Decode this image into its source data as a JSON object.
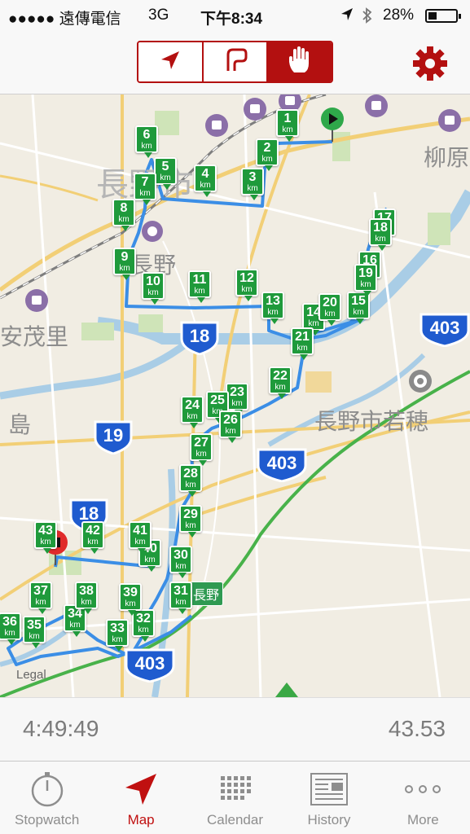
{
  "status_bar": {
    "signal": "●●●●●",
    "carrier": "遠傳電信",
    "network": "3G",
    "time": "下午8:34",
    "battery": "28%"
  },
  "toolbar": {
    "segments": [
      {
        "name": "navigation-arrow-icon",
        "active": false
      },
      {
        "name": "route-shape-icon",
        "active": false
      },
      {
        "name": "hand-icon",
        "active": true
      }
    ],
    "settings_icon": "gear-icon",
    "accent_color": "#b31010"
  },
  "map": {
    "labels": {
      "nagano_city": "長野市",
      "yanagihara": "柳原",
      "nagano": "長野",
      "amori": "安茂里",
      "shima": "島",
      "wakaho": "長野市若穂",
      "nagano_station": "長野"
    },
    "legal": "Legal",
    "route_color": "#3b8ee6",
    "markers": [
      {
        "n": "1"
      },
      {
        "n": "2"
      },
      {
        "n": "3"
      },
      {
        "n": "4"
      },
      {
        "n": "5"
      },
      {
        "n": "6"
      },
      {
        "n": "7"
      },
      {
        "n": "8"
      },
      {
        "n": "9"
      },
      {
        "n": "10"
      },
      {
        "n": "11"
      },
      {
        "n": "12"
      },
      {
        "n": "13"
      },
      {
        "n": "14"
      },
      {
        "n": "15"
      },
      {
        "n": "16"
      },
      {
        "n": "17"
      },
      {
        "n": "18"
      },
      {
        "n": "19"
      },
      {
        "n": "20"
      },
      {
        "n": "21"
      },
      {
        "n": "22"
      },
      {
        "n": "23"
      },
      {
        "n": "24"
      },
      {
        "n": "25"
      },
      {
        "n": "26"
      },
      {
        "n": "27"
      },
      {
        "n": "28"
      },
      {
        "n": "29"
      },
      {
        "n": "30"
      },
      {
        "n": "31"
      },
      {
        "n": "32"
      },
      {
        "n": "33"
      },
      {
        "n": "34"
      },
      {
        "n": "35"
      },
      {
        "n": "36"
      },
      {
        "n": "37"
      },
      {
        "n": "38"
      },
      {
        "n": "39"
      },
      {
        "n": "40"
      },
      {
        "n": "41"
      },
      {
        "n": "42"
      },
      {
        "n": "43"
      }
    ],
    "km_unit": "km",
    "shields": [
      "18",
      "403",
      "19",
      "403",
      "18",
      "403"
    ]
  },
  "summary": {
    "elapsed": "4:49:49",
    "distance": "43.53"
  },
  "tabs": [
    {
      "label": "Stopwatch",
      "icon": "stopwatch-icon",
      "active": false
    },
    {
      "label": "Map",
      "icon": "map-arrow-icon",
      "active": true
    },
    {
      "label": "Calendar",
      "icon": "calendar-icon",
      "active": false
    },
    {
      "label": "History",
      "icon": "history-icon",
      "active": false
    },
    {
      "label": "More",
      "icon": "more-icon",
      "active": false
    }
  ]
}
